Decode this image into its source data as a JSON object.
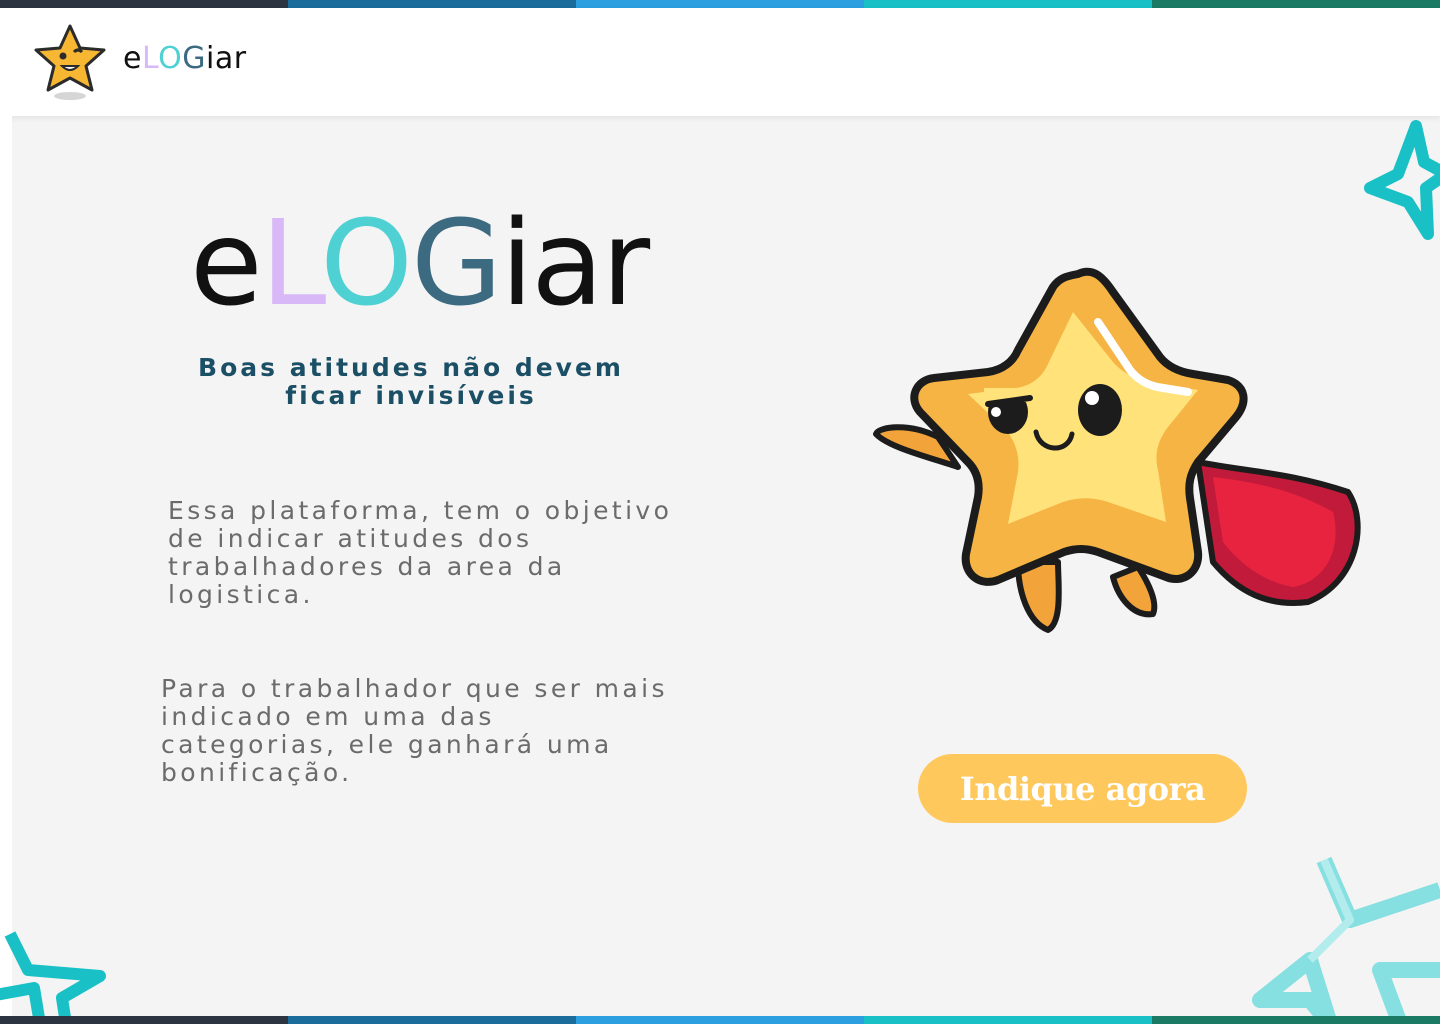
{
  "header": {
    "logo_icon": "star-mascot-icon",
    "brand": {
      "part1": "e",
      "part2": "L",
      "part3": "O",
      "part4": "G",
      "part5": "iar"
    }
  },
  "hero": {
    "brand": {
      "part1": "e",
      "part2": "L",
      "part3": "O",
      "part4": "G",
      "part5": "iar"
    },
    "tagline_line1": "Boas atitudes não devem",
    "tagline_line2": "ficar invisíveis",
    "paragraph1": "Essa plataforma, tem o objetivo de indicar  atitudes dos trabalhadores da area da logistica.",
    "paragraph2": "Para o  trabalhador que ser mais indicado em uma das categorias, ele ganhará uma bonificação.",
    "illustration": "superhero-star-icon"
  },
  "cta": {
    "label": "Indique agora"
  },
  "colors": {
    "brand_dark": "#111111",
    "brand_lilac": "#d9b8f7",
    "brand_teal": "#4fd1d3",
    "brand_slate": "#3c6a80",
    "tagline": "#1b4f66",
    "body_text": "#6b6b6b",
    "cta_bg": "#ffc85c",
    "stripe": [
      "#2b3440",
      "#1b6c9a",
      "#2b9fe0",
      "#19c1c6",
      "#1a7a63"
    ]
  }
}
